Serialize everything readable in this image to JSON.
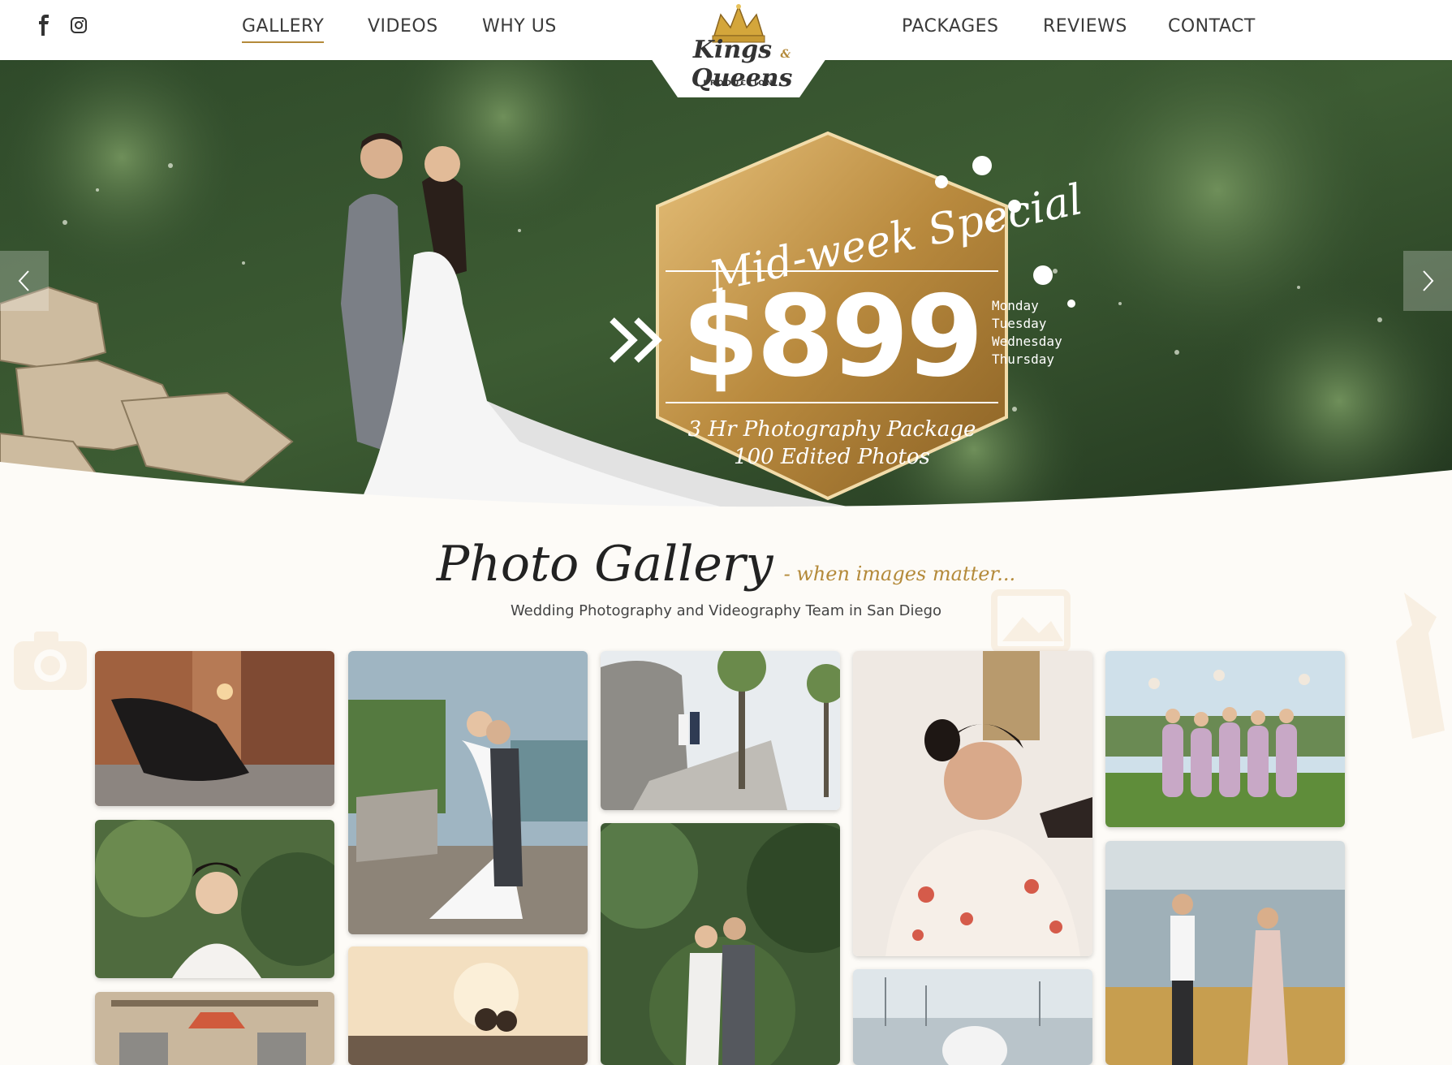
{
  "header": {
    "social": [
      {
        "name": "facebook-icon"
      },
      {
        "name": "instagram-icon"
      }
    ],
    "nav_left": [
      {
        "label": "GALLERY",
        "active": true
      },
      {
        "label": "VIDEOS",
        "active": false
      },
      {
        "label": "WHY US",
        "active": false
      }
    ],
    "nav_right": [
      {
        "label": "PACKAGES"
      },
      {
        "label": "REVIEWS"
      },
      {
        "label": "CONTACT"
      }
    ],
    "logo": {
      "line1": "Kings",
      "amp": "&",
      "line2": "Queens",
      "sub": "PRODUCTION"
    }
  },
  "hero": {
    "promo_title_1": "Mid-week",
    "promo_title_2": "Special",
    "price": "$899",
    "days": [
      "Monday",
      "Tuesday",
      "Wednesday",
      "Thursday"
    ],
    "package_line": "3 Hr Photography Package",
    "photos_line": "100 Edited Photos",
    "prev_icon": "chevron-left-icon",
    "next_icon": "chevron-right-icon"
  },
  "gallery": {
    "title": "Photo Gallery",
    "tagline": "- when images matter...",
    "subtitle": "Wedding Photography and Videography Team in San Diego"
  },
  "colors": {
    "gold": "#b48a3a",
    "background": "#fdfbf7",
    "nav_text": "#3a3a3a"
  }
}
